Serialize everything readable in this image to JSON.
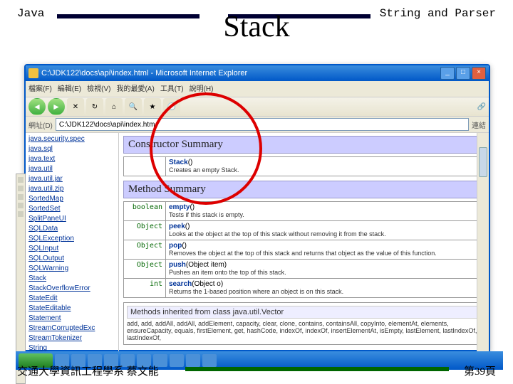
{
  "header": {
    "left": "Java",
    "right": "String and Parser",
    "title": "Stack"
  },
  "footer": {
    "left": "交通大學資訊工程學系 蔡文能",
    "right": "第39頁"
  },
  "browser": {
    "title": "C:\\JDK122\\docs\\api\\index.html - Microsoft Internet Explorer",
    "menus": [
      "檔案(F)",
      "編輯(E)",
      "檢視(V)",
      "我的最愛(A)",
      "工具(T)",
      "說明(H)"
    ],
    "address_label": "網址(D)",
    "address": "C:\\JDK122\\docs\\api\\index.htm",
    "link_label": "連結"
  },
  "sidebar": [
    "java.security.spec",
    "java.sql",
    "java.text",
    "java.util",
    "java.util.jar",
    "java.util.zip",
    "",
    "SortedMap",
    "SortedSet",
    "SplitPaneUI",
    "SQLData",
    "SQLException",
    "SQLInput",
    "SQLOutput",
    "SQLWarning",
    "Stack",
    "StackOverflowError",
    "StateEdit",
    "StateEditable",
    "Statement",
    "StreamCorruptedExc",
    "StreamTokenizer",
    "String"
  ],
  "doc": {
    "constructor_heading": "Constructor Summary",
    "constructor_name": "Stack",
    "constructor_desc": "Creates an empty Stack.",
    "method_heading": "Method Summary",
    "methods": [
      {
        "ret": "boolean",
        "name": "empty",
        "sig": "()",
        "desc": "Tests if this stack is empty."
      },
      {
        "ret": "Object",
        "name": "peek",
        "sig": "()",
        "desc": "Looks at the object at the top of this stack without removing it from the stack."
      },
      {
        "ret": "Object",
        "name": "pop",
        "sig": "()",
        "desc": "Removes the object at the top of this stack and returns that object as the value of this function."
      },
      {
        "ret": "Object",
        "name": "push",
        "sig": "(Object item)",
        "desc": "Pushes an item onto the top of this stack."
      },
      {
        "ret": "int",
        "name": "search",
        "sig": "(Object o)",
        "desc": "Returns the 1-based position where an object is on this stack."
      }
    ],
    "inherited_heading": "Methods inherited from class java.util.Vector",
    "inherited_list": "add, add, addAll, addAll, addElement, capacity, clear, clone, contains, containsAll, copyInto, elementAt, elements, ensureCapacity, equals, firstElement, get, hashCode, indexOf, indexOf, insertElementAt, isEmpty, lastElement, lastIndexOf, lastIndexOf,"
  }
}
